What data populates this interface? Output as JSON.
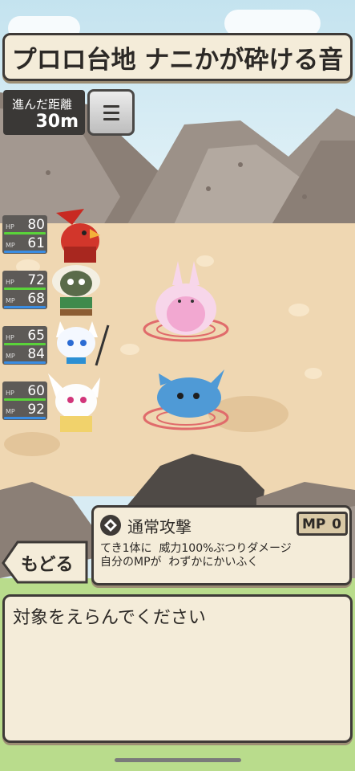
{
  "stage": {
    "title": "プロロ台地 ナニかが砕ける音"
  },
  "distance": {
    "label": "進んだ距離",
    "value": "30m"
  },
  "party": [
    {
      "name_icon": "red-bird-warrior",
      "hp_label": "HP",
      "hp": "80",
      "mp_label": "MP",
      "mp": "61"
    },
    {
      "name_icon": "sheep-hunter",
      "hp_label": "HP",
      "hp": "72",
      "mp_label": "MP",
      "mp": "68"
    },
    {
      "name_icon": "white-cat-lancer",
      "hp_label": "HP",
      "hp": "65",
      "mp_label": "MP",
      "mp": "84"
    },
    {
      "name_icon": "white-rabbit-priest",
      "hp_label": "HP",
      "hp": "60",
      "mp_label": "MP",
      "mp": "92"
    }
  ],
  "skill": {
    "icon": "diamond-emblem-icon",
    "name": "通常攻撃",
    "mp_label": "MP",
    "mp_cost": "0",
    "description": "てき1体に  威力100%ぶつりダメージ\n自分のMPが  わずかにかいふく"
  },
  "back_button": {
    "label": "もどる"
  },
  "message": {
    "text": "対象をえらんでください"
  },
  "colors": {
    "panel": "#f4ecd9",
    "border": "#3e3a37",
    "hp_bar": "#5ad33a",
    "mp_bar": "#3a8de3"
  }
}
